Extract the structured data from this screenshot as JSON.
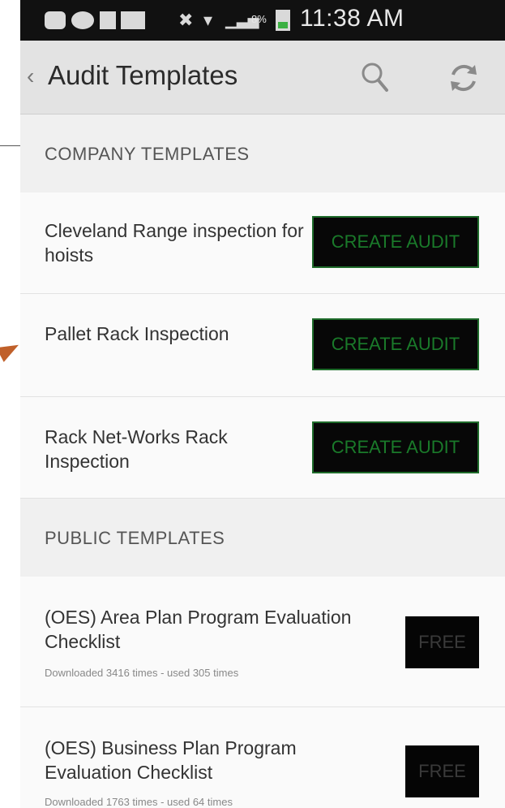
{
  "status": {
    "battery_pct": "8%",
    "time": "11:38 AM"
  },
  "header": {
    "title": "Audit Templates",
    "back_icon": "chevron-left-icon",
    "search_icon": "search-icon",
    "refresh_icon": "refresh-icon"
  },
  "sections": {
    "company": "COMPANY TEMPLATES",
    "public": "PUBLIC TEMPLATES"
  },
  "company_templates": [
    {
      "name": "Cleveland Range inspection for hoists",
      "action": "CREATE AUDIT"
    },
    {
      "name": "Pallet Rack Inspection",
      "action": "CREATE AUDIT"
    },
    {
      "name": "Rack Net-Works Rack Inspection",
      "action": "CREATE AUDIT"
    }
  ],
  "public_templates": [
    {
      "name": "(OES) Area Plan Program Evaluation Checklist",
      "meta": "Downloaded 3416 times - used 305 times",
      "action": "FREE"
    },
    {
      "name": "(OES) Business Plan Program Evaluation Checklist",
      "meta": "Downloaded 1763 times - used 64 times",
      "action": "FREE"
    }
  ],
  "colors": {
    "button_bg": "#070707",
    "button_text": "#1a7a2a",
    "actionbar_bg": "#e3e3e3"
  }
}
